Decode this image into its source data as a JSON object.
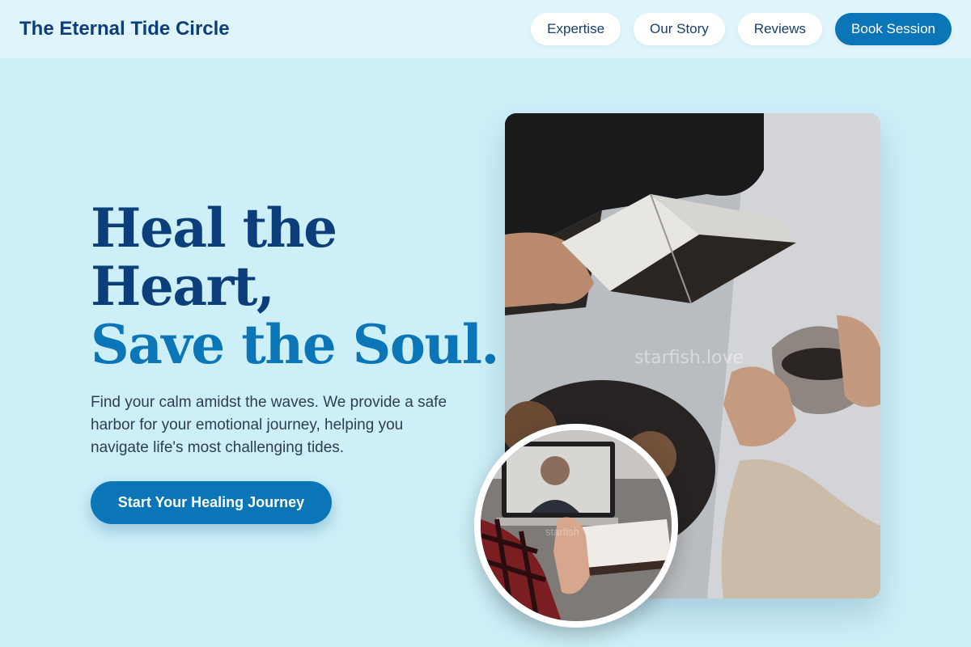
{
  "header": {
    "brand": "The Eternal Tide Circle",
    "nav": [
      {
        "label": "Expertise"
      },
      {
        "label": "Our Story"
      },
      {
        "label": "Reviews"
      },
      {
        "label": "Book Session"
      }
    ]
  },
  "hero": {
    "title_line1": "Heal the",
    "title_line2": "Heart,",
    "title_line3": "Save the Soul.",
    "description": "Find your calm amidst the waves. We provide a safe harbor for your emotional journey, helping you navigate life's most challenging tides.",
    "cta_label": "Start Your Healing Journey"
  },
  "images": {
    "main_watermark": "starfish.love",
    "circle_watermark": "starfish"
  },
  "colors": {
    "background": "#cdeff8",
    "navy": "#0b3e7a",
    "accent": "#0a76b8",
    "white": "#ffffff"
  }
}
